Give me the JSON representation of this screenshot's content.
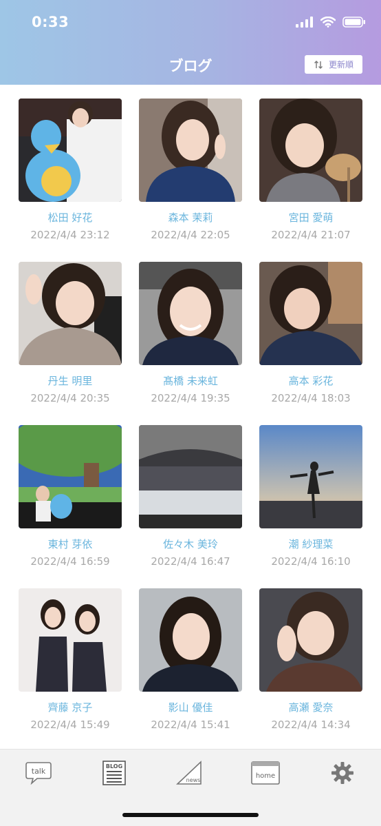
{
  "status_bar": {
    "time": "0:33"
  },
  "header": {
    "title": "ブログ",
    "sort_label": "更新順"
  },
  "posts": [
    {
      "name": "松田 好花",
      "date": "2022/4/4 23:12"
    },
    {
      "name": "森本 茉莉",
      "date": "2022/4/4 22:05"
    },
    {
      "name": "宮田 愛萌",
      "date": "2022/4/4 21:07"
    },
    {
      "name": "丹生 明里",
      "date": "2022/4/4 20:35"
    },
    {
      "name": "髙橋 未来虹",
      "date": "2022/4/4 19:35"
    },
    {
      "name": "高本 彩花",
      "date": "2022/4/4 18:03"
    },
    {
      "name": "東村 芽依",
      "date": "2022/4/4 16:59"
    },
    {
      "name": "佐々木 美玲",
      "date": "2022/4/4 16:47"
    },
    {
      "name": "潮 紗理菜",
      "date": "2022/4/4 16:10"
    },
    {
      "name": "齊藤 京子",
      "date": "2022/4/4 15:49"
    },
    {
      "name": "影山 優佳",
      "date": "2022/4/4 15:41"
    },
    {
      "name": "高瀬 愛奈",
      "date": "2022/4/4 14:34"
    }
  ],
  "tabbar": {
    "talk": {
      "label": "talk"
    },
    "blog": {
      "label": "BLOG"
    },
    "news": {
      "label": "news"
    },
    "home": {
      "label": "home"
    },
    "settings": {
      "icon": "gear-icon"
    }
  },
  "colors": {
    "accent": "#6ab5dd",
    "header_left": "#9ec6e6",
    "header_right": "#b59be0",
    "date": "#a8a8a8"
  }
}
